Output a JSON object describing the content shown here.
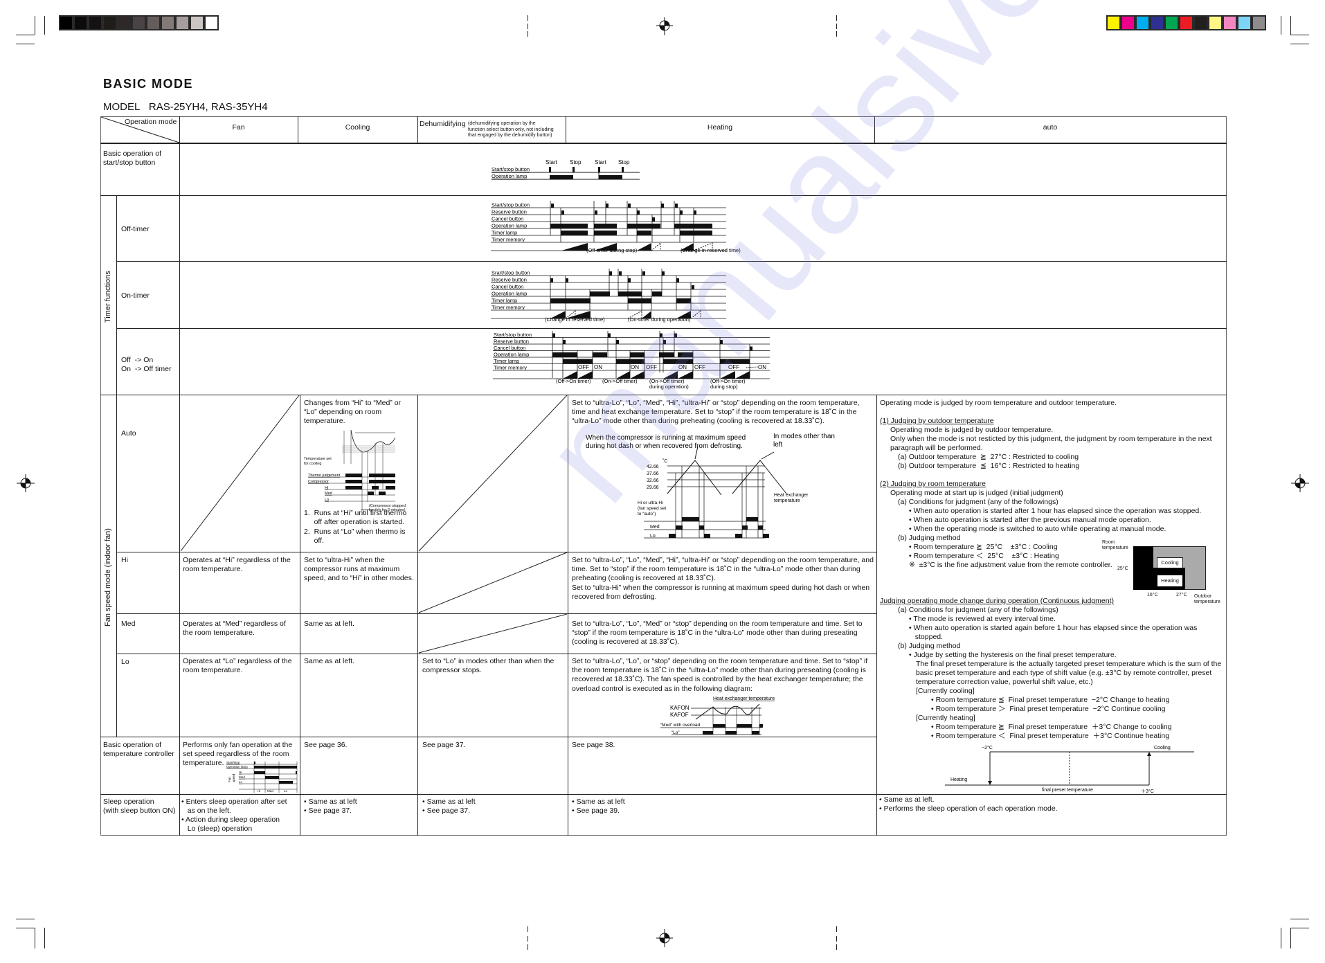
{
  "page": {
    "title": "BASIC MODE",
    "model_label": "MODEL",
    "model_value": "RAS-25YH4, RAS-35YH4"
  },
  "print_marks": {
    "gray_swatches": [
      "#000000",
      "#0c0a0a",
      "#141212",
      "#1f1c1a",
      "#2e2828",
      "#4a4345",
      "#655d5c",
      "#837977",
      "#a69e9c",
      "#cbc6c4",
      "#ffffff"
    ],
    "color_swatches": [
      "#fff200",
      "#ec008c",
      "#00aeef",
      "#2e3192",
      "#00a651",
      "#ed1c24",
      "#231f20",
      "#fff685",
      "#f286c0",
      "#7fd3f7",
      "#8c8c8c"
    ]
  },
  "table": {
    "corner_label": "Operation mode",
    "columns": {
      "fan": "Fan",
      "cooling": "Cooling",
      "dehumidifying": "Dehumidifying",
      "dehumidifying_note": "(dehumidifying operation by the\nfunction select button only, not including\nthat engaged by the dehumidify button)",
      "heating": "Heating",
      "auto": "auto"
    },
    "rows": {
      "basic_start_stop": "Basic operation of\nstart/stop button",
      "timer_group": "Timer functions",
      "off_timer": "Off-timer",
      "on_timer": "On-timer",
      "off_on_timer": "Off  -> On\nOn  -> Off timer",
      "fan_group": "Fan speed mode (indoor fan)",
      "auto": "Auto",
      "hi": "Hi",
      "med": "Med",
      "lo": "Lo",
      "temp_controller": "Basic operation of\ntemperature controller",
      "sleep": "Sleep operation\n(with sleep button ON)"
    },
    "start_stop_diagram": {
      "labels": [
        "Start",
        "Stop",
        "Start",
        "Stop"
      ],
      "signals": [
        "Start/stop button",
        "Operation lamp"
      ]
    },
    "timer_signals": [
      "Start/stop button",
      "Reserve button",
      "Cancel button",
      "Operation lamp",
      "Timer lamp",
      "Timer memory"
    ],
    "on_timer_first_signal": "Srart/stop button",
    "off_timer_captions": [
      "(Off-timer during stop)",
      "(Change in reserved time)"
    ],
    "on_timer_captions": [
      "(Change in reserved time)",
      "(On-timer during operation)"
    ],
    "off_on_captions": [
      "(Off->On timer)",
      "(On->Off timer)",
      "(On->Off timer)\n during operation)",
      "(Off->On timer)\n during stop)"
    ],
    "off_on_memory_tags": [
      "OFF",
      "ON",
      "ON",
      "OFF",
      "ON",
      "OFF",
      "OFF",
      "ON"
    ],
    "cells": {
      "cooling_auto": "Changes from “Hi” to “Med” or\n“Lo” depending on room\ntemperature.",
      "cooling_auto_diagram": {
        "set_label": "Temperature set\nfor cooling",
        "signals": [
          "Thermo judgement",
          "Compressor",
          "Hi",
          "Med",
          "Lo"
        ],
        "note": "(Compressor stopped\n forcibly for 3 minutes)"
      },
      "cooling_auto_list": [
        "1.  Runs at “Hi” until first thermo\n     off after operation is started.",
        "2.  Runs at “Lo” when thermo is\n     off."
      ],
      "heating_auto": "Set to “ultra-Lo”, “Lo”, “Med”, “Hi”, “ultra-Hi” or “stop” depending on the room temperature,\ntime and heat exchange temperature. Set to “stop” if the room temperature is 18˚C in the\n“ultra-Lo” mode other than during preheating (cooling is recovered at 18.33˚C).",
      "heating_auto_diagram": {
        "note_left": "When the compressor is running at maximum speed\nduring hot dash or when recovered from defrosting.",
        "note_right": "In modes other than\nleft",
        "unit": "˚C",
        "levels": [
          "42.66",
          "37.66",
          "32.66",
          "29.66"
        ],
        "hx_label": "Heat exchanger\ntemperature",
        "rows": [
          "Hi or ultra-Hi\n(fan speed set\nto “auto”)",
          "Med",
          "Lo"
        ]
      },
      "fan_hi": "Operates at “Hi” regardless of the\nroom temperature.",
      "cooling_hi": "Set to “ultra-Hi” when the\ncompressor runs at maximum\nspeed, and to “Hi” in other modes.",
      "heating_hi": "Set to “ultra-Lo”, “Lo”, “Med”, “Hi”, “ultra-Hi” or “stop” depending on the room temperature, and\ntime. Set to “stop” if the room temperature is 18˚C in the “ultra-Lo” mode other than during\npreheating (cooling is recovered at 18.33˚C).\nSet to “ultra-Hi” when the compressor is running at maximum speed during hot dash or when\nrecovered from defrosting.",
      "fan_med": "Operates at “Med” regardless of\nthe room temperature.",
      "cooling_med": "Same as at left.",
      "heating_med": "Set to “ultra-Lo”, “Lo”, “Med” or “stop” depending on the room temperature and time. Set to\n“stop” if the room temperature is 18˚C in the “ultra-Lo” mode other than during preseating\n(cooling is recovered at 18.33˚C).",
      "fan_lo": "Operates at “Lo” regardless of the\nroom temperature.",
      "cooling_lo": "Same as at left.",
      "dehum_lo": "Set to “Lo” in modes other than when the\ncompressor stops.",
      "heating_lo": "Set to “ultra-Lo”, “Lo”, or “stop” depending on the room temperature and time. Set to “stop” if\nthe room temperature is 18˚C in the “ultra-Lo” mode other than during preseating (cooling is\nrecovered at 18.33˚C). The fan speed is controlled by the heat exchanger temperature; the\noverload control is executed as in the following diagram:",
      "heating_lo_diagram": {
        "title": "Heat exchanger temperature",
        "levels": [
          "KAFON",
          "KAFOF"
        ],
        "rows": [
          "“Med” with overload",
          "“Lo”"
        ]
      },
      "fan_temp_ctrl": "Performs only fan operation at the\nset speed regardless of the room\ntemperature.",
      "fan_temp_ctrl_diagram": {
        "signals": [
          "Start/stop",
          "Operation lamp",
          "Hi",
          "Med",
          "Lo"
        ],
        "axis_label": "Fan\nspeed",
        "bottom": [
          "Hi",
          "Med",
          "Lo"
        ]
      },
      "cooling_temp_ctrl": "See page 36.",
      "dehum_temp_ctrl": "See page 37.",
      "heating_temp_ctrl": "See page 38.",
      "fan_sleep": [
        "• Enters sleep operation after set\n   as on the left.",
        "• Action during sleep operation\n   Lo (sleep) operation"
      ],
      "cooling_sleep": [
        "• Same as at left",
        "• See page 37."
      ],
      "dehum_sleep": [
        "• Same as at left",
        "• See page 37."
      ],
      "heating_sleep": [
        "• Same as at left",
        "• See page 39."
      ],
      "auto_sleep": [
        "• Same as at left.",
        "• Performs the sleep operation of each operation mode."
      ]
    },
    "auto_text": {
      "intro": "Operating mode is judged by room temperature and outdoor temperature.",
      "s1_title": "(1) Judging by outdoor temperature",
      "s1_body": "Operating mode is judged by outdoor temperature.\nOnly when the mode is not resticted by this judgment, the judgment by room temperature in the next\nparagraph will be performed.",
      "s1_a": "(a) Outdoor temperature  ≧  27°C : Restricted to cooling",
      "s1_b": "(b) Outdoor temperature  ≦  16°C : Restricted to heating",
      "s2_title": "(2) Judging by room temperature",
      "s2_body": "Operating mode at start up is judged (initial judgment)",
      "s2_a": "(a) Conditions for judgment (any of the followings)",
      "s2_a_items": [
        "• When auto operation is started after 1 hour has elapsed since the operation was stopped.",
        "• When auto operation is started after the previous manual mode operation.",
        "• When the operating mode is switched to auto while operating at manual mode."
      ],
      "s2_b": "(b) Judging method",
      "s2_b_items": [
        "• Room temperature ≧  25°C    ±3°C : Cooling",
        "• Room temperature ＜  25°C    ±3°C : Heating",
        "※  ±3°C is the fine adjustment value from the remote controller."
      ],
      "map": {
        "y_label": "Room\ntemperature",
        "y_tick": "25°C",
        "x_ticks": [
          "16°C",
          "27°C"
        ],
        "x_label": "Outdoor\ntemperature",
        "cooling": "Cooling",
        "heating": "Heating"
      },
      "s3_title": "Judging operating mode change during operation (Continuous judgment)",
      "s3_a": "(a) Conditions for judgment (any of the followings)",
      "s3_a_items": [
        "• The mode is reviewed at every interval time.",
        "• When auto operation is started again before 1 hour has elapsed since the operation was\n   stopped."
      ],
      "s3_b": "(b) Judging method",
      "s3_b_item": "• Judge by setting the hysteresis on the final preset temperature.",
      "s3_b_body": "The final preset temperature is the actually targeted preset temperature which is the sum of the\nbasic preset temperature and each type of shift value (e.g. ±3°C by remote controller, preset\ntemperature correction value, powerful shift value, etc.)",
      "cur_cool": "[Currently cooling]",
      "cur_cool_items": [
        "• Room temperature ≦  Final preset temperature  −2°C Change to heating",
        "• Room temperature ＞  Final preset temperature  −2°C Continue cooling"
      ],
      "cur_heat": "[Currently heating]",
      "cur_heat_items": [
        "• Room temperature ≧  Final preset temperature  ＋3°C Change to cooling",
        "• Room temperature ＜  Final preset temperature  ＋3°C Continue heating"
      ],
      "hyst": {
        "minus": "−2°C",
        "cooling": "Cooling",
        "heating": "Heating",
        "center": "final preset temperature",
        "plus": "＋3°C"
      }
    }
  }
}
